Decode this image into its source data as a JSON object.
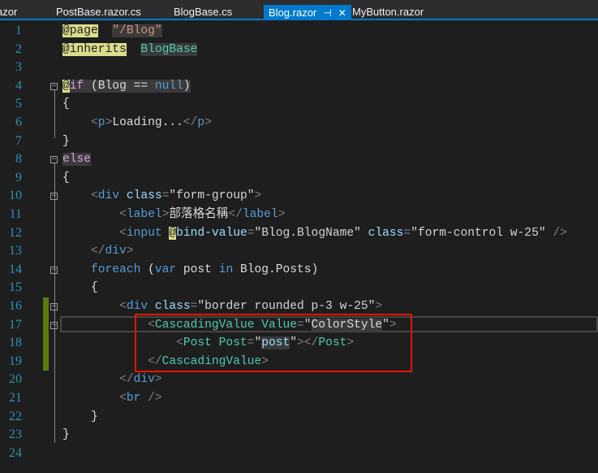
{
  "tabs": [
    {
      "label": "azor",
      "active": false
    },
    {
      "label": "PostBase.razor.cs",
      "active": false
    },
    {
      "label": "BlogBase.cs",
      "active": false
    },
    {
      "label": "Blog.razor",
      "active": true
    },
    {
      "label": "MyButton.razor",
      "active": false
    }
  ],
  "tab_icons": {
    "pin": "⊣",
    "close": "✕"
  },
  "lines": [
    [
      [
        "r",
        "@page"
      ],
      [
        "",
        "  "
      ],
      [
        "s h",
        "\"/Blog\""
      ]
    ],
    [
      [
        "r",
        "@inherits"
      ],
      [
        "",
        "  "
      ],
      [
        "c h",
        "BlogBase"
      ]
    ],
    [],
    [
      [
        "r",
        "@"
      ],
      [
        "p h",
        "if"
      ],
      [
        "h",
        " (Blog == "
      ],
      [
        "k h",
        "null"
      ],
      [
        "h",
        ")"
      ]
    ],
    [
      [
        "",
        "{"
      ]
    ],
    [
      [
        "",
        "    "
      ],
      [
        "d",
        "<"
      ],
      [
        "t",
        "p"
      ],
      [
        "d",
        ">"
      ],
      [
        "",
        "Loading..."
      ],
      [
        "d",
        "</"
      ],
      [
        "t",
        "p"
      ],
      [
        "d",
        ">"
      ]
    ],
    [
      [
        "",
        "}"
      ]
    ],
    [
      [
        "p h",
        "else"
      ]
    ],
    [
      [
        "",
        "{"
      ]
    ],
    [
      [
        "",
        "    "
      ],
      [
        "d",
        "<"
      ],
      [
        "t",
        "div"
      ],
      [
        "a",
        " class"
      ],
      [
        "d",
        "="
      ],
      [
        "v",
        "\"form-group\""
      ],
      [
        "d",
        ">"
      ]
    ],
    [
      [
        "",
        "        "
      ],
      [
        "d",
        "<"
      ],
      [
        "t",
        "label"
      ],
      [
        "d",
        ">"
      ],
      [
        "",
        "部落格名稱"
      ],
      [
        "d",
        "</"
      ],
      [
        "t",
        "label"
      ],
      [
        "d",
        ">"
      ]
    ],
    [
      [
        "",
        "        "
      ],
      [
        "d",
        "<"
      ],
      [
        "t",
        "input"
      ],
      [
        "",
        "",
        " "
      ],
      [
        "r",
        "@"
      ],
      [
        "a",
        "bind-value"
      ],
      [
        "d",
        "="
      ],
      [
        "v",
        "\"Blog.BlogName\""
      ],
      [
        "a",
        " class"
      ],
      [
        "d",
        "="
      ],
      [
        "v",
        "\"form-control w-25\""
      ],
      [
        "d",
        " />"
      ]
    ],
    [
      [
        "",
        "    "
      ],
      [
        "d",
        "</"
      ],
      [
        "t",
        "div"
      ],
      [
        "d",
        ">"
      ]
    ],
    [
      [
        "",
        "    "
      ],
      [
        "k",
        "foreach"
      ],
      [
        "",
        " ("
      ],
      [
        "k",
        "var"
      ],
      [
        "",
        " post "
      ],
      [
        "k",
        "in"
      ],
      [
        "",
        " Blog.Posts)"
      ]
    ],
    [
      [
        "",
        "    {"
      ]
    ],
    [
      [
        "",
        "        "
      ],
      [
        "d",
        "<"
      ],
      [
        "t",
        "div"
      ],
      [
        "a",
        " class"
      ],
      [
        "d",
        "="
      ],
      [
        "v",
        "\"border rounded p-3 w-25\""
      ],
      [
        "d",
        ">"
      ]
    ],
    [
      [
        "",
        "            "
      ],
      [
        "d",
        "<"
      ],
      [
        "c",
        "CascadingValue"
      ],
      [
        "c",
        " Value"
      ],
      [
        "d",
        "="
      ],
      [
        "v",
        "\""
      ],
      [
        "h",
        "ColorStyle"
      ],
      [
        "v",
        "\""
      ],
      [
        "d",
        ">"
      ]
    ],
    [
      [
        "",
        "                "
      ],
      [
        "d",
        "<"
      ],
      [
        "c",
        "Post"
      ],
      [
        "c",
        " Post"
      ],
      [
        "d",
        "="
      ],
      [
        "v",
        "\""
      ],
      [
        "a h",
        "post"
      ],
      [
        "v",
        "\""
      ],
      [
        "d",
        "></"
      ],
      [
        "c",
        "Post"
      ],
      [
        "d",
        ">"
      ]
    ],
    [
      [
        "",
        "            "
      ],
      [
        "d",
        "</"
      ],
      [
        "c",
        "CascadingValue"
      ],
      [
        "d",
        ">"
      ]
    ],
    [
      [
        "",
        "        "
      ],
      [
        "d",
        "</"
      ],
      [
        "t",
        "div"
      ],
      [
        "d",
        ">"
      ]
    ],
    [
      [
        "",
        "        "
      ],
      [
        "d",
        "<"
      ],
      [
        "t",
        "br"
      ],
      [
        "d",
        " />"
      ]
    ],
    [
      [
        "",
        "    }"
      ]
    ],
    [
      [
        "",
        "}"
      ]
    ],
    []
  ]
}
